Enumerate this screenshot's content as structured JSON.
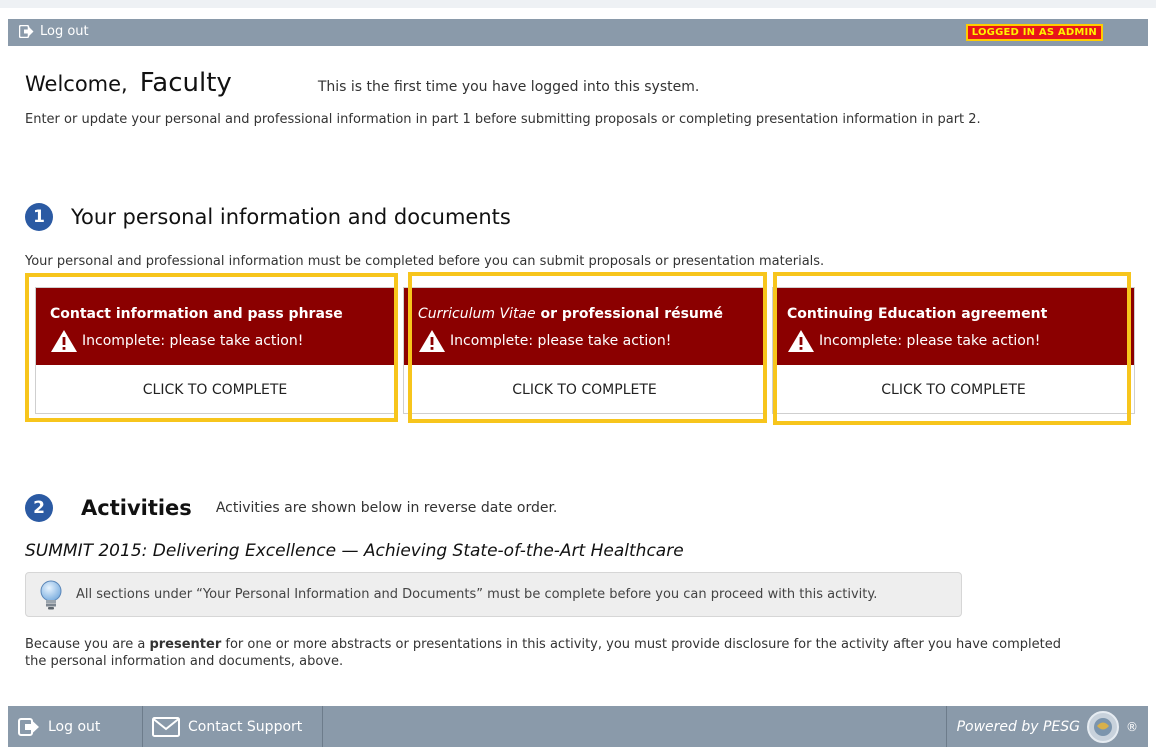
{
  "topbar": {
    "logout_label": "Log out",
    "admin_badge": "LOGGED IN AS ADMIN"
  },
  "welcome": {
    "greeting": "Welcome,",
    "name": "Faculty",
    "first_time": "This is the first time you have logged into this system.",
    "intro": "Enter or update your personal and professional information in part 1 before submitting proposals or completing presentation information in part 2."
  },
  "section1": {
    "number": "1",
    "title": "Your personal information and documents",
    "description": "Your personal and professional information must be completed before you can submit proposals or presentation materials.",
    "cards": [
      {
        "title": "Contact information and pass phrase",
        "status": "Incomplete: please take action!",
        "action": "CLICK TO COMPLETE"
      },
      {
        "title_italic": "Curriculum Vitae",
        "title_rest": " or professional résumé",
        "status": "Incomplete: please take action!",
        "action": "CLICK TO COMPLETE"
      },
      {
        "title": "Continuing Education agreement",
        "status": "Incomplete: please take action!",
        "action": "CLICK TO COMPLETE"
      }
    ]
  },
  "section2": {
    "number": "2",
    "title": "Activities",
    "subtitle": "Activities are shown below in reverse date order.",
    "activity_title": "SUMMIT 2015: Delivering Excellence — Achieving State-of-the-Art Healthcare",
    "notice": "All sections under “Your Personal Information and Documents” must be complete before you can proceed with this activity.",
    "explain_before": "Because you are a ",
    "explain_bold": "presenter",
    "explain_after": " for one or more abstracts or presentations in this activity, you must provide disclosure for the activity after you have completed the personal information and documents, above."
  },
  "footer": {
    "logout_label": "Log out",
    "contact_label": "Contact Support",
    "powered_label": "Powered by PESG",
    "registered": "®"
  },
  "colors": {
    "card_header": "#8b0000",
    "highlight": "#f7c51c",
    "bar": "#8a9aaa",
    "step_circle": "#2b5aa3",
    "admin_badge_bg": "#e8141a"
  }
}
